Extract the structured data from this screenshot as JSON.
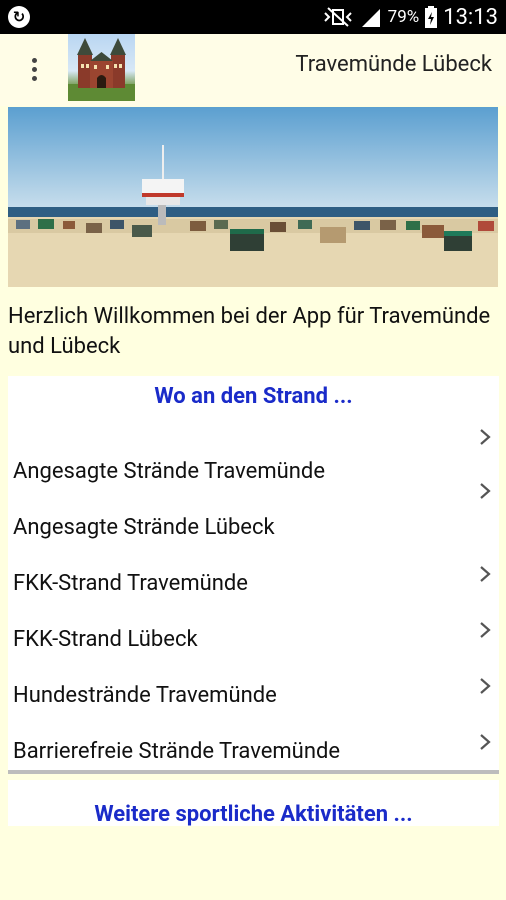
{
  "status_bar": {
    "battery": "79%",
    "time": "13:13",
    "left_icon": "sync-icon",
    "right_icons": [
      "mute-vibrate-icon",
      "signal-icon",
      "battery-icon"
    ]
  },
  "app_bar": {
    "title": "Travemünde Lübeck",
    "menu_icon": "overflow-menu-icon",
    "logo_icon": "holstentor-logo"
  },
  "welcome_text": "Herzlich Willkommen bei der App für Travemünde und Lübeck",
  "section1": {
    "heading": "Wo an den Strand ...",
    "items": [
      {
        "label": "Angesagte Strände Travemünde"
      },
      {
        "label": "Angesagte Strände Lübeck"
      },
      {
        "label": "FKK-Strand Travemünde"
      },
      {
        "label": "FKK-Strand Lübeck"
      },
      {
        "label": "Hundestrände Travemünde"
      },
      {
        "label": "Barrierefreie Strände Travemünde"
      }
    ]
  },
  "section2": {
    "heading": "Weitere sportliche Aktivitäten ..."
  },
  "colors": {
    "background": "#ffffe0",
    "heading": "#1a2bc9",
    "status_bar": "#000000"
  }
}
